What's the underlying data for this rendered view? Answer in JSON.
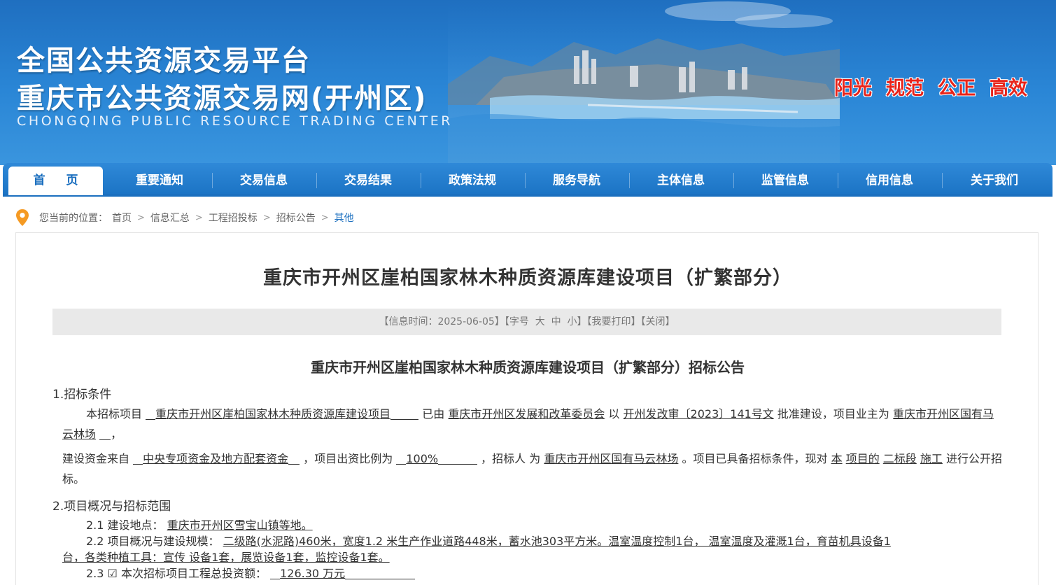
{
  "banner": {
    "title1": "全国公共资源交易平台",
    "title2": "重庆市公共资源交易网(开州区)",
    "subtitle": "CHONGQING PUBLIC RESOURCE TRADING CENTER",
    "slogans": [
      "阳光",
      "规范",
      "公正",
      "高效"
    ]
  },
  "nav": {
    "items": [
      "首页",
      "重要通知",
      "交易信息",
      "交易结果",
      "政策法规",
      "服务导航",
      "主体信息",
      "监管信息",
      "信用信息",
      "关于我们"
    ]
  },
  "breadcrumb": {
    "prefix": "您当前的位置：",
    "items": [
      "首页",
      "信息汇总",
      "工程招投标",
      "招标公告",
      "其他"
    ]
  },
  "article": {
    "title": "重庆市开州区崖柏国家林木种质资源库建设项目（扩繁部分）",
    "info": {
      "time_label": "【信息时间：2025-06-05】",
      "font_label": "【字号",
      "font_large": "大",
      "font_medium": "中",
      "font_small": "小】",
      "print": "【我要打印】",
      "close": "【关闭】"
    },
    "subtitle": "重庆市开州区崖柏国家林木种质资源库建设项目（扩繁部分）招标公告",
    "sec1_title": "1.招标条件",
    "p1": {
      "t1": "本招标项目",
      "project": "重庆市开州区崖柏国家林木种质资源库建设项目",
      "t2": "已由",
      "approver": "重庆市开州区发展和改革委员会",
      "t3": "以",
      "doc": "开州发改审〔2023〕141号文",
      "t4": "批准建设，项目业主为",
      "owner": "重庆市开州区国有马云林场",
      "t5": "，"
    },
    "p2": {
      "t1": "建设资金来自",
      "fund": "中央专项资金及地方配套资金",
      "t2": "，项目出资比例为",
      "ratio": "100%",
      "t3": "，招标人 为",
      "tenderer": "重庆市开州区国有马云林场",
      "t4": "。项目已具备招标条件，现对",
      "this": "本",
      "proj": "项目的",
      "section": "二标段",
      "work": "施工",
      "t5": "进行公开招标。"
    },
    "sec2_title": "2.项目概况与招标范围",
    "s21": {
      "label": "2.1  建设地点：",
      "value": "重庆市开州区雪宝山镇等地。"
    },
    "s22": {
      "label": "2.2  项目概况与建设规模：",
      "line1": "二级路(水泥路)460米，宽度1.2    米生产作业道路448米，蓄水池303平方米。温室温度控制1台，  温室温度及灌溉1台，育苗机具设备1",
      "line2": "台，各类种植工具：宣传    设备1套，展览设备1套，监控设备1套。"
    },
    "s23": {
      "label": "2.3",
      "check": "☑",
      "text": "本次招标项目工程总投资额：",
      "value": "126.30 万元"
    }
  }
}
